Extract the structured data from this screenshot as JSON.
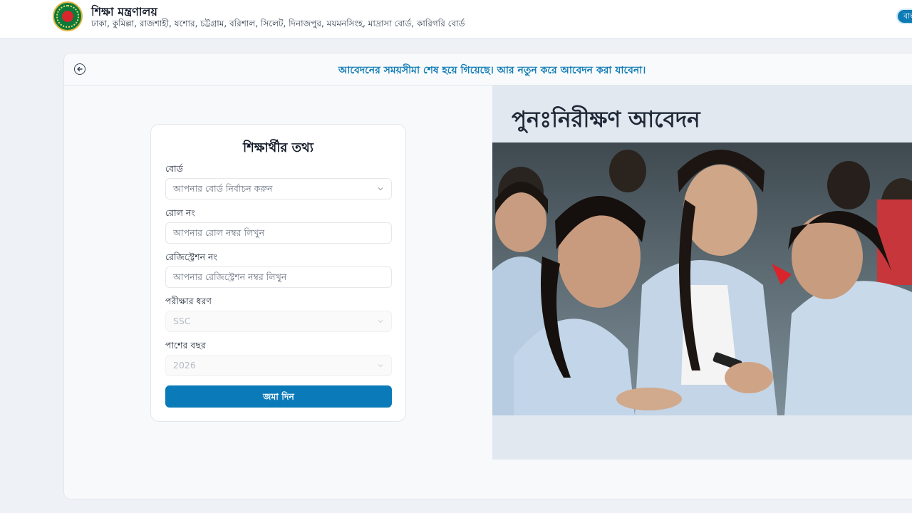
{
  "header": {
    "title": "শিক্ষা মন্ত্রণালয়",
    "subtitle": "ঢাকা, কুমিল্লা, রাজশাহী, যশোর, চট্টগ্রাম, বরিশাল, সিলেট, দিনাজপুর, ময়মনসিংহ, মাদ্রাসা বোর্ড, কারিগরি বোর্ড",
    "lang_toggle": "বাং"
  },
  "notice": {
    "text": "আবেদনের সময়সীমা শেষ হয়ে গিয়েছে। আর নতুন করে আবেদন করা যাবেনা।"
  },
  "form": {
    "title": "শিক্ষার্থীর তথ্য",
    "board_label": "বোর্ড",
    "board_placeholder": "আপনার বোর্ড নির্বাচন করুন",
    "roll_label": "রোল নং",
    "roll_placeholder": "আপনার রোল নম্বর লিখুন",
    "reg_label": "রেজিস্ট্রেশন নং",
    "reg_placeholder": "আপনার রেজিস্ট্রেশন নম্বর লিখুন",
    "exam_label": "পরীক্ষার ধরণ",
    "exam_value": "SSC",
    "year_label": "পাশের বছর",
    "year_value": "2026",
    "submit_label": "জমা দিন"
  },
  "right": {
    "title": "পুনঃনিরীক্ষণ আবেদন"
  },
  "colors": {
    "accent": "#0a7ab8",
    "notice_text": "#0e7bb5",
    "page_bg": "#eef2f6"
  },
  "icons": {
    "back": "arrow-left-circle-icon",
    "select": "chevron-down-icon"
  }
}
